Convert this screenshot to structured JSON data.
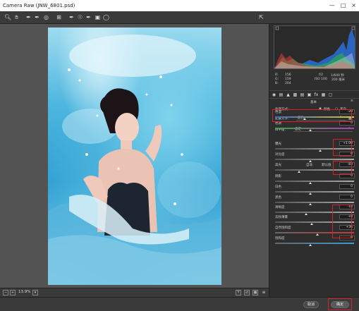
{
  "window": {
    "title": "Camera Raw (JNW_6801.psd)",
    "min": "—",
    "max": "□",
    "close": "×"
  },
  "statusbar": {
    "zoom": "13.9%"
  },
  "info": {
    "r": "R:",
    "g": "G:",
    "b": "B:",
    "r_val": "156",
    "g_val": "159",
    "b_val": "204",
    "aperture": "f/2",
    "shutter": "1/640 秒",
    "iso": "ISO 100",
    "focal": "200 毫米"
  },
  "basic": {
    "heading": "基本",
    "treatment_label": "处理方式：",
    "treatment_color": "颜色",
    "treatment_bw": "黑白",
    "profile_label": "配置文件：",
    "profile_value": "颜色",
    "wb_label": "白平衡：",
    "wb_value": "自定",
    "auto": "自动",
    "default": "默认值",
    "sliders": [
      {
        "label": "色温",
        "value": "-20"
      },
      {
        "label": "色调",
        "value": "0"
      },
      {
        "label": "曝光",
        "value": "+1.00"
      },
      {
        "label": "对比度",
        "value": "0"
      },
      {
        "label": "高光",
        "value": "-83"
      },
      {
        "label": "阴影",
        "value": "0"
      },
      {
        "label": "白色",
        "value": "0"
      },
      {
        "label": "黑色",
        "value": "0"
      },
      {
        "label": "清晰度",
        "value": "-18"
      },
      {
        "label": "去除薄雾",
        "value": "+8"
      },
      {
        "label": "自然饱和度",
        "value": "+36"
      },
      {
        "label": "饱和度",
        "value": "0"
      }
    ]
  },
  "buttons": {
    "cancel": "取消",
    "ok": "确定"
  },
  "colors": {
    "highlight": "#d8222a",
    "panel_bg": "#2e2e2e",
    "canvas_bg": "#535353"
  }
}
